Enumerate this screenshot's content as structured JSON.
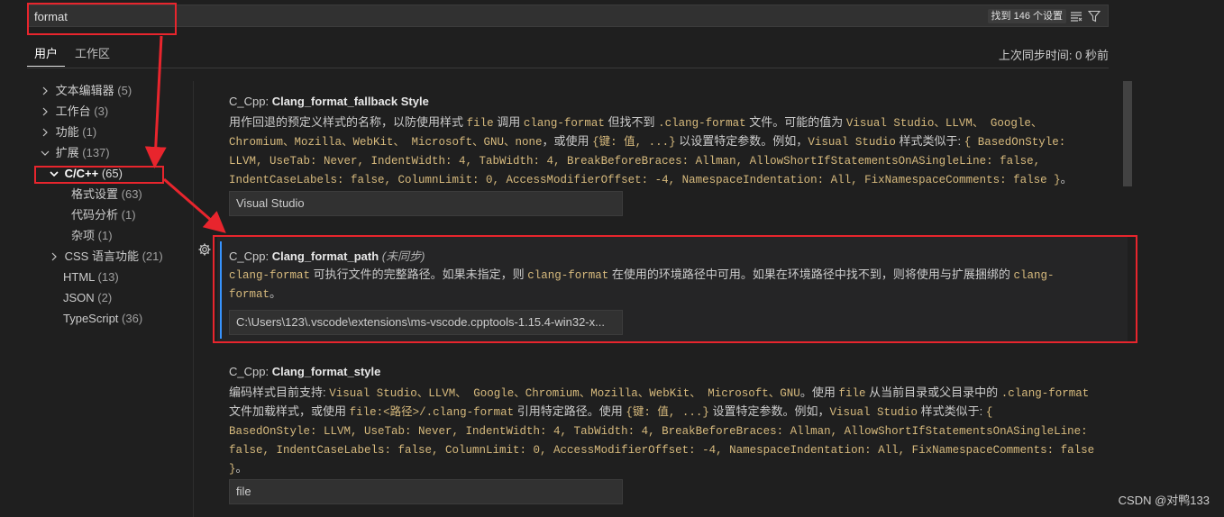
{
  "search": {
    "value": "format",
    "result_count": "找到 146 个设置"
  },
  "tabs": [
    {
      "label": "用户",
      "active": true
    },
    {
      "label": "工作区",
      "active": false
    }
  ],
  "last_sync": "上次同步时间: 0 秒前",
  "tree": {
    "items": [
      {
        "label": "文本编辑器",
        "count": "(5)"
      },
      {
        "label": "工作台",
        "count": "(3)"
      },
      {
        "label": "功能",
        "count": "(1)"
      },
      {
        "label": "扩展",
        "count": "(137)"
      },
      {
        "label": "C/C++",
        "count": "(65)"
      },
      {
        "label": "格式设置",
        "count": "(63)"
      },
      {
        "label": "代码分析",
        "count": "(1)"
      },
      {
        "label": "杂项",
        "count": "(1)"
      },
      {
        "label": "CSS 语言功能",
        "count": "(21)"
      },
      {
        "label": "HTML",
        "count": "(13)"
      },
      {
        "label": "JSON",
        "count": "(2)"
      },
      {
        "label": "TypeScript",
        "count": "(36)"
      }
    ]
  },
  "settings": [
    {
      "prefix": "C_Cpp: ",
      "name": "Clang_format_fallback Style",
      "value": "Visual Studio",
      "desc": {
        "l1a": "用作回退的预定义样式的名称，以防使用样式 ",
        "l1b": "file",
        "l1c": " 调用 ",
        "l1d": "clang-format",
        "l1e": " 但找不到 ",
        "l1f": ".clang-format",
        "l1g": " 文件。可能的值为 ",
        "l1h": "Visual Studio、LLVM、 Google、",
        "l2a": "Chromium、Mozilla、WebKit、 Microsoft、GNU、none",
        "l2b": "，或使用 ",
        "l2c": "{键: 值, ...}",
        "l2d": " 以设置特定参数。例如，",
        "l2e": "Visual Studio",
        "l2f": " 样式类似于: ",
        "l2g": "{ BasedOnStyle:",
        "l3": "LLVM, UseTab: Never, IndentWidth: 4, TabWidth: 4, BreakBeforeBraces: Allman, AllowShortIfStatementsOnASingleLine: false,",
        "l4a": "IndentCaseLabels: false, ColumnLimit: 0, AccessModifierOffset: -4, NamespaceIndentation: All, FixNamespaceComments: false }",
        "l4b": "。"
      }
    },
    {
      "prefix": "C_Cpp: ",
      "name": "Clang_format_path",
      "tag": "(未同步)",
      "value": "C:\\Users\\123\\.vscode\\extensions\\ms-vscode.cpptools-1.15.4-win32-x...",
      "desc": {
        "l1a": "clang-format",
        "l1b": " 可执行文件的完整路径。如果未指定，则 ",
        "l1c": "clang-format",
        "l1d": " 在使用的环境路径中可用。如果在环境路径中找不到，则将使用与扩展捆绑的 ",
        "l1e": "clang-",
        "l2a": "format",
        "l2b": "。"
      }
    },
    {
      "prefix": "C_Cpp: ",
      "name": "Clang_format_style",
      "value": "file",
      "desc": {
        "l1a": "编码样式目前支持: ",
        "l1b": "Visual Studio、LLVM、 Google、Chromium、Mozilla、WebKit、 Microsoft、GNU",
        "l1c": "。使用 ",
        "l1d": "file",
        "l1e": " 从当前目录或父目录中的 ",
        "l1f": ".clang-format",
        "l2a": "文件加载样式，或使用 ",
        "l2b": "file:<路径>/.clang-format",
        "l2c": " 引用特定路径。使用 ",
        "l2d": "{键: 值, ...}",
        "l2e": " 设置特定参数。例如，",
        "l2f": "Visual Studio",
        "l2g": " 样式类似于: ",
        "l2h": "{",
        "l3": "BasedOnStyle: LLVM, UseTab: Never, IndentWidth: 4, TabWidth: 4, BreakBeforeBraces: Allman, AllowShortIfStatementsOnASingleLine:",
        "l4": "false, IndentCaseLabels: false, ColumnLimit: 0, AccessModifierOffset: -4, NamespaceIndentation: All, FixNamespaceComments: false",
        "l5a": "}",
        "l5b": "。"
      }
    }
  ],
  "watermark": "CSDN @对鸭133",
  "colors": {
    "background": "#1f1f1f",
    "code_text": "#d7ba7d",
    "annotation_red": "#e8252d",
    "focus_blue": "#3794ff"
  },
  "icons": [
    "filter-list-icon",
    "filter-icon",
    "chevron-right-icon",
    "chevron-down-icon",
    "gear-icon"
  ]
}
